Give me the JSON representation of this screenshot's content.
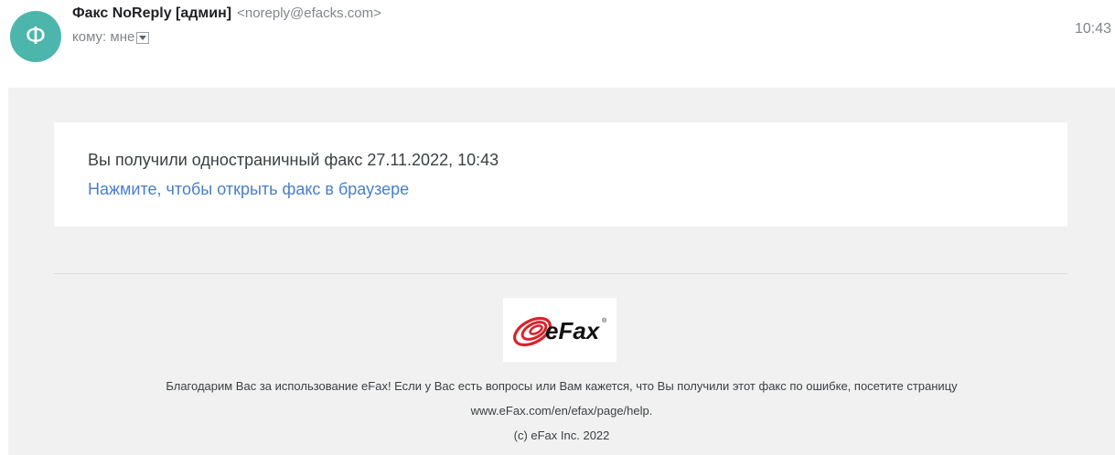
{
  "header": {
    "avatar_letter": "Ф",
    "sender_name": "Факс NoReply [админ]",
    "sender_email": "<noreply@efacks.com>",
    "to_label": "кому: мне",
    "time": "10:43"
  },
  "message": {
    "text": "Вы получили одностраничный факс 27.11.2022, 10:43",
    "link": "Нажмите, чтобы открыть факс в браузере"
  },
  "logo": {
    "text": "eFax",
    "registered": "®"
  },
  "footer": {
    "line1": "Благодарим Вас за использование eFax! Если у Вас есть вопросы или Вам кажется, что Вы получили этот факс по ошибке, посетите страницу",
    "line2": "www.eFax.com/en/efax/page/help.",
    "line3": "(c) eFax Inc. 2022"
  },
  "colors": {
    "avatar": "#4db6ac",
    "link": "#4a7ec9",
    "logo_red": "#d9232d"
  }
}
